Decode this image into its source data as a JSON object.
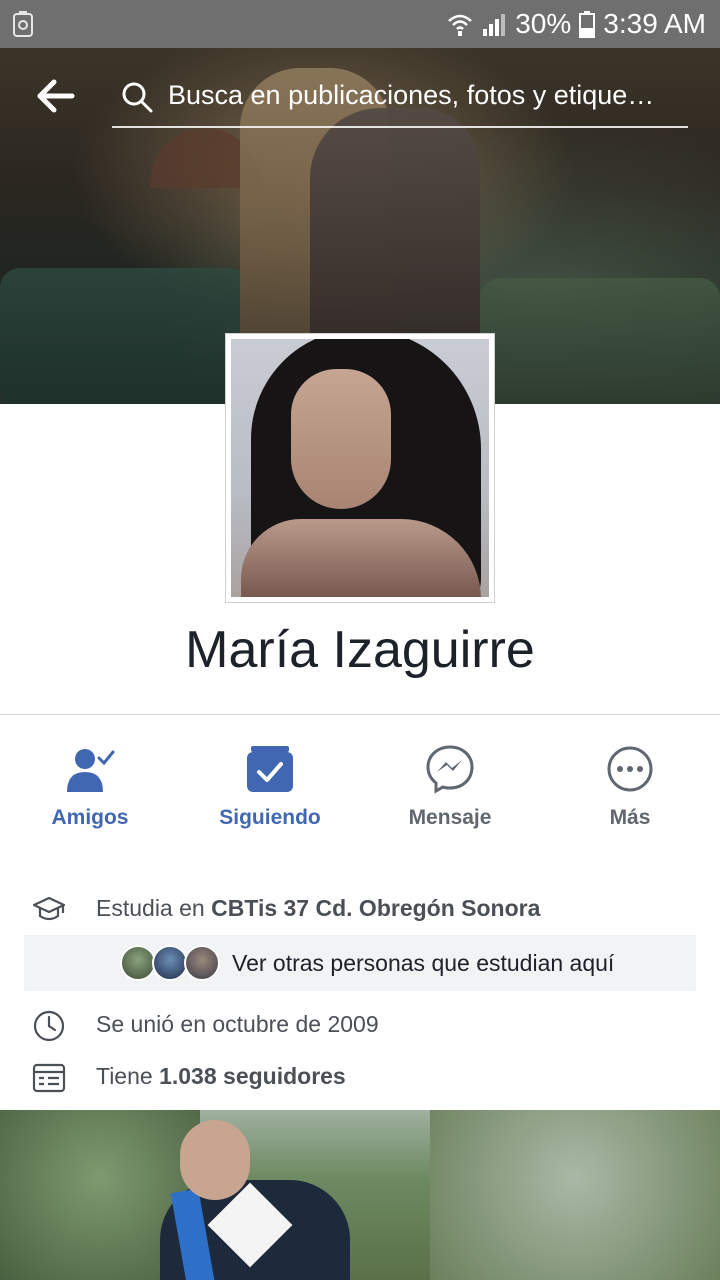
{
  "status_bar": {
    "signal_icon": "wifi-signal-icon",
    "battery_percent": "30%",
    "time": "3:39 AM"
  },
  "header": {
    "search_placeholder": "Busca en publicaciones, fotos y etique…"
  },
  "profile": {
    "name": "María Izaguirre"
  },
  "actions": [
    {
      "label": "Amigos",
      "icon": "friends-check-icon",
      "color": "#4267b2"
    },
    {
      "label": "Siguiendo",
      "icon": "following-check-icon",
      "color": "#4267b2"
    },
    {
      "label": "Mensaje",
      "icon": "messenger-icon",
      "color": "#606770"
    },
    {
      "label": "Más",
      "icon": "more-icon",
      "color": "#606770"
    }
  ],
  "info": {
    "study_prefix": "Estudia en ",
    "study_school": "CBTis 37 Cd. Obregón Sonora",
    "classmates_link": "Ver otras personas que estudian aquí",
    "joined": "Se unió en octubre de 2009",
    "followers_prefix": "Tiene ",
    "followers_value": "1.038 seguidores"
  },
  "colors": {
    "accent": "#4267b2",
    "status_bar": "#6f6f6f",
    "text_primary": "#1d2129",
    "text_secondary": "#4b4f56"
  }
}
